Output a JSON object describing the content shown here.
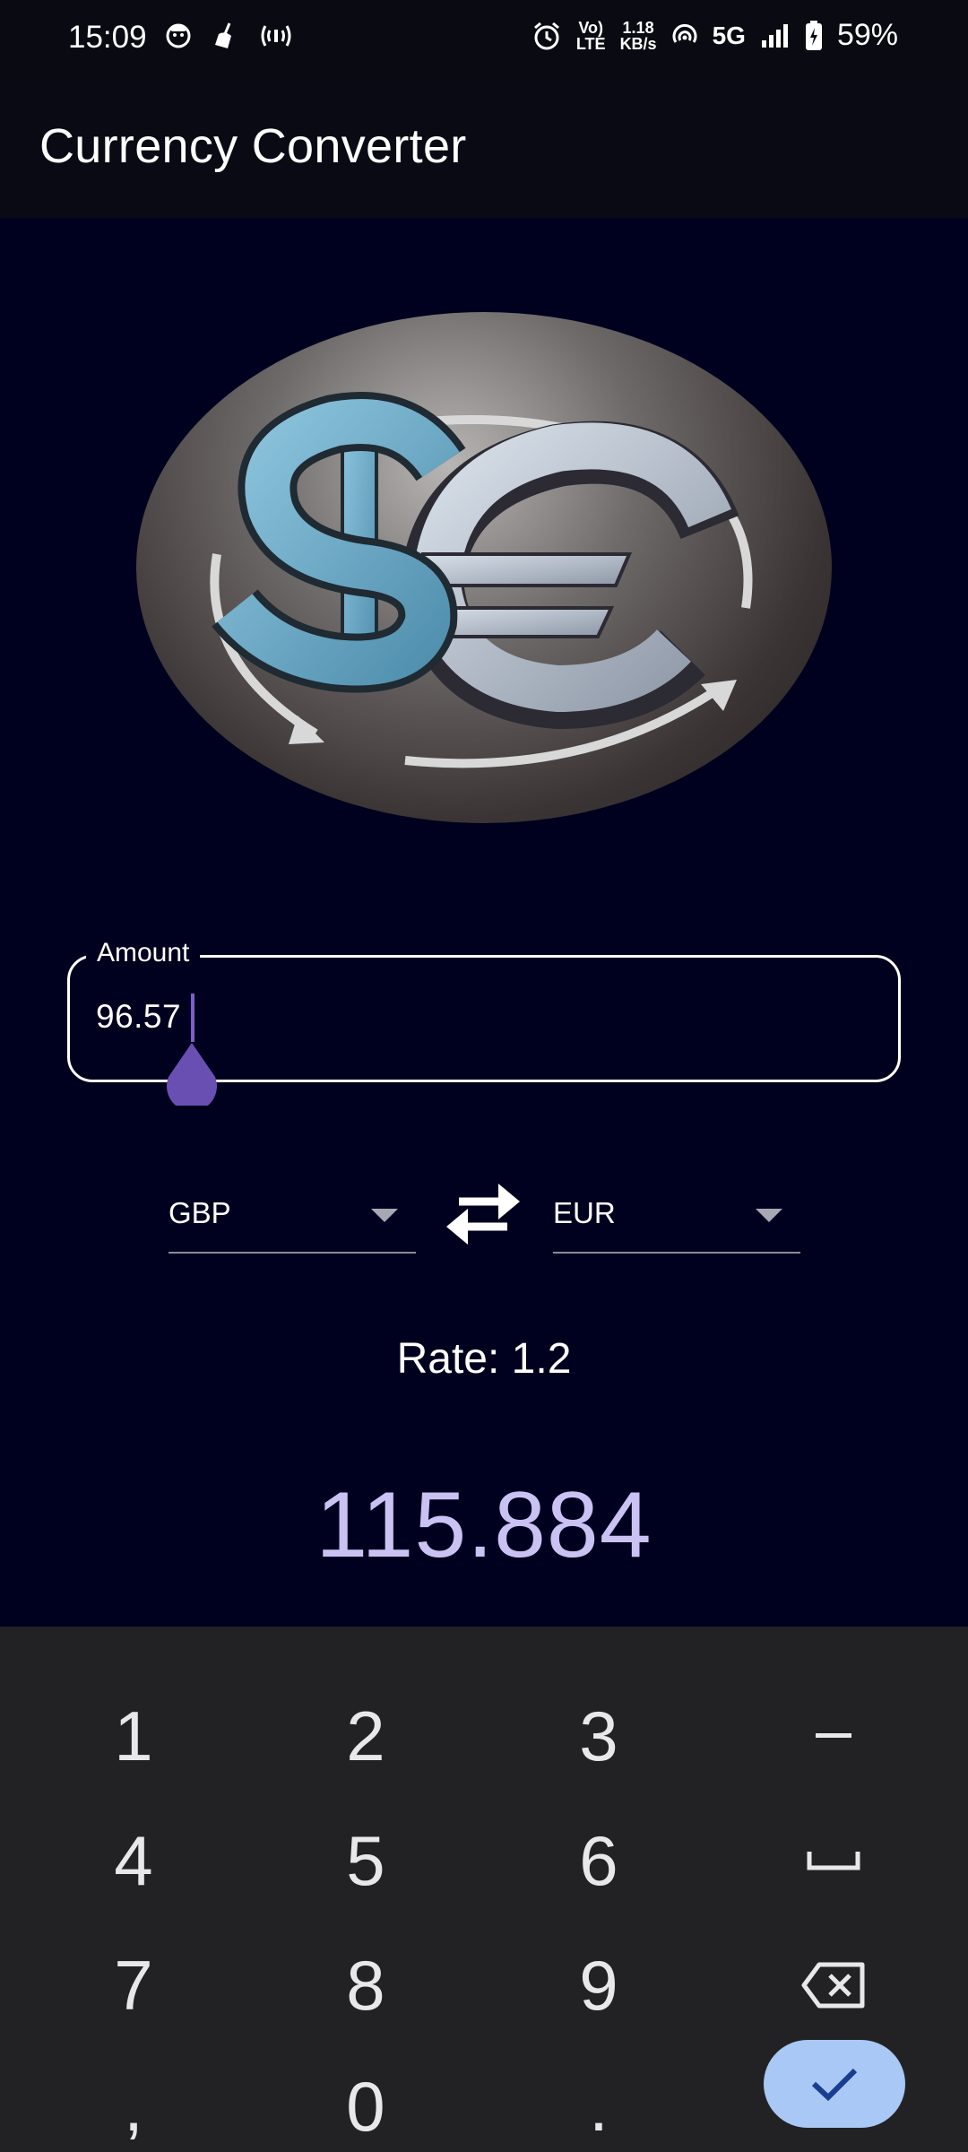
{
  "status_bar": {
    "time": "15:09",
    "net_speed_value": "1.18",
    "net_speed_unit": "KB/s",
    "volte_top": "Vo)",
    "volte_bottom": "LTE",
    "network": "5G",
    "battery": "59%"
  },
  "app_bar": {
    "title": "Currency Converter"
  },
  "amount": {
    "label": "Amount",
    "value": "96.57"
  },
  "from_currency": "GBP",
  "to_currency": "EUR",
  "rate_text": "Rate: 1.2",
  "result": "115.884",
  "keyboard": {
    "rows": [
      [
        "1",
        "2",
        "3",
        "–"
      ],
      [
        "4",
        "5",
        "6",
        "␣"
      ],
      [
        "7",
        "8",
        "9",
        "⌫"
      ],
      [
        ",",
        "0",
        ".",
        "✓"
      ]
    ]
  },
  "colors": {
    "background": "#00001f",
    "app_bar": "#0a0a14",
    "result": "#c9c2f2",
    "cursor": "#7c5fc9",
    "keyboard": "#222225",
    "done_key": "#a9c8f5"
  }
}
